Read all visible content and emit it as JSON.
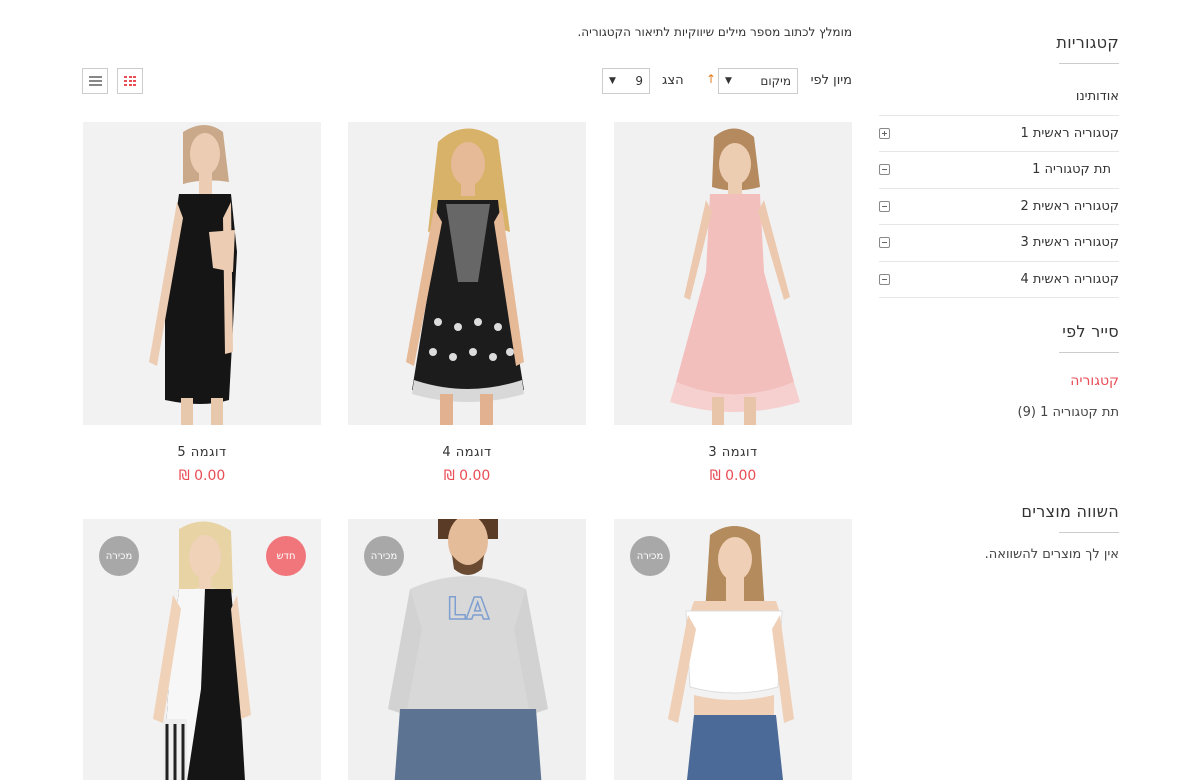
{
  "sidebar": {
    "categories_title": "קטגוריות",
    "categories": [
      {
        "label": "אודותינו",
        "toggle": "none"
      },
      {
        "label": "קטגוריה ראשית 1",
        "toggle": "plus"
      },
      {
        "label": "תת קטגוריה 1",
        "toggle": "minus"
      },
      {
        "label": "קטגוריה ראשית 2",
        "toggle": "minus"
      },
      {
        "label": "קטגוריה ראשית 3",
        "toggle": "minus"
      },
      {
        "label": "קטגוריה ראשית 4",
        "toggle": "minus"
      }
    ],
    "filter_title": "סייר לפי",
    "filter_active": "קטגוריה",
    "filter_option": "תת קטגוריה 1 (9)",
    "compare_title": "השווה מוצרים",
    "compare_text": "אין לך מוצרים להשוואה."
  },
  "main": {
    "description": "מומלץ לכתוב מספר מילים שיווקיות לתיאור הקטגוריה.",
    "sort_label": "מיון לפי",
    "sort_value": "מיקום",
    "sort_direction_icon": "↑",
    "show_label": "הצג",
    "show_value": "9"
  },
  "products": [
    {
      "name": "דוגמה 3",
      "price": "0.00 ₪"
    },
    {
      "name": "דוגמה 4",
      "price": "0.00 ₪"
    },
    {
      "name": "דוגמה 5",
      "price": "0.00 ₪"
    },
    {
      "badge_sale": "מכירה"
    },
    {
      "badge_sale": "מכירה"
    },
    {
      "badge_sale": "מכירה",
      "badge_new": "חדש"
    }
  ],
  "colors": {
    "accent": "#e94d55",
    "sale_badge": "#a8a8a8",
    "new_badge": "#f0767b"
  }
}
